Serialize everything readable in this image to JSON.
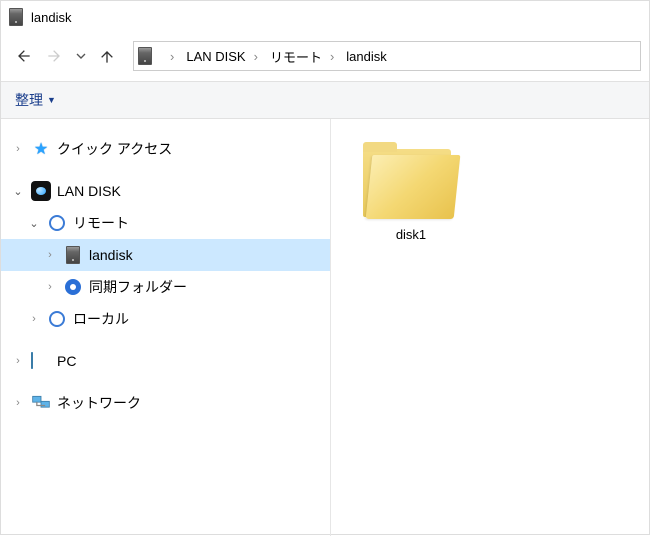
{
  "window": {
    "title": "landisk"
  },
  "breadcrumbs": [
    {
      "label": "LAN DISK"
    },
    {
      "label": "リモート"
    },
    {
      "label": "landisk"
    }
  ],
  "toolbar": {
    "organize_label": "整理"
  },
  "tree": {
    "quick_access": "クイック アクセス",
    "landisk": "LAN DISK",
    "remote": "リモート",
    "landisk_node": "landisk",
    "sync_folder": "同期フォルダー",
    "local": "ローカル",
    "pc": "PC",
    "network": "ネットワーク"
  },
  "content": {
    "items": [
      {
        "label": "disk1"
      }
    ]
  }
}
